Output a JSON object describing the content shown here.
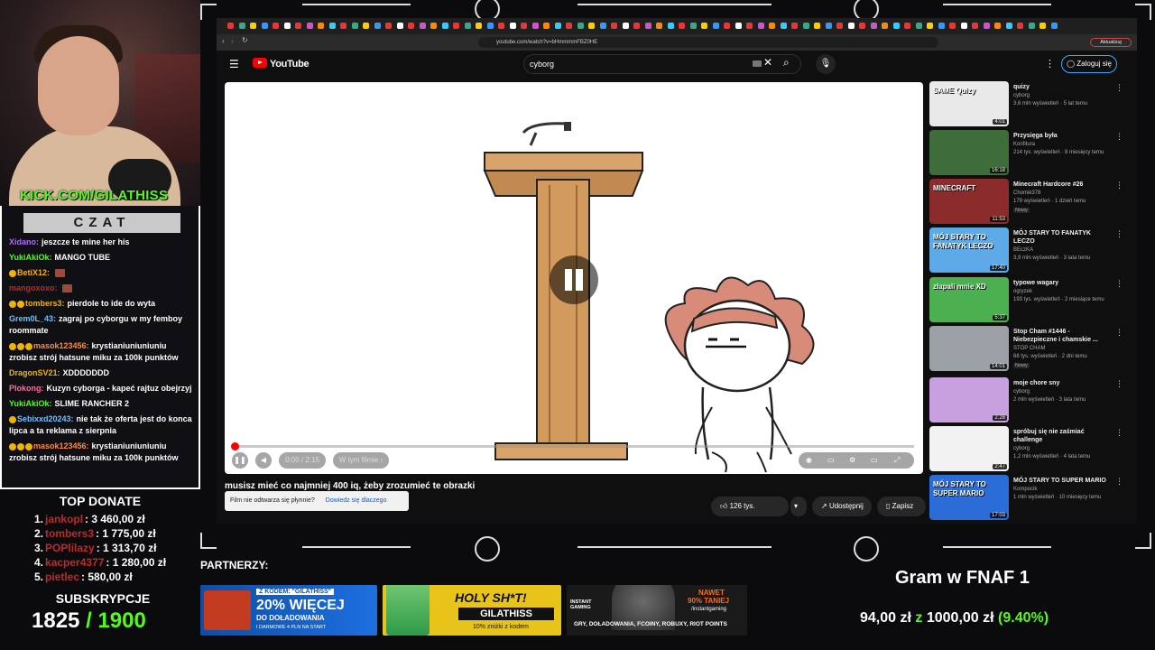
{
  "stream": {
    "kick_url": "KICK.COM/GILATHISS",
    "chat_title": "CZAT",
    "chat": [
      {
        "user": "Xidano:",
        "color": "#b266ff",
        "badges": 0,
        "text": "jeszcze te mine her his"
      },
      {
        "user": "YukiAkiOk:",
        "color": "#53fc18",
        "badges": 0,
        "text": "MANGO TUBE"
      },
      {
        "user": "BetiX12:",
        "color": "#f0b400",
        "badges": 1,
        "text": "",
        "emote": true
      },
      {
        "user": "mangoxoxo:",
        "color": "#c0282a",
        "badges": 0,
        "text": "",
        "emote": true
      },
      {
        "user": "tombers3:",
        "color": "#f0b400",
        "badges": 2,
        "text": "pierdole to ide do wyta"
      },
      {
        "user": "Grem0L_43:",
        "color": "#6ec1ff",
        "badges": 0,
        "text": "zagraj po cyborgu w my femboy roommate"
      },
      {
        "user": "masok123456:",
        "color": "#ff8a3d",
        "badges": 3,
        "text": "krystianiuniuniuniu zrobisz strój hatsune miku za 100k punktów"
      },
      {
        "user": "DragonSV21:",
        "color": "#f0b400",
        "badges": 0,
        "text": "XDDDDDDD"
      },
      {
        "user": "Plokong:",
        "color": "#ff6b9d",
        "badges": 0,
        "text": "Kuzyn cyborga - kapeć rajtuz obejrzyj"
      },
      {
        "user": "YukiAkiOk:",
        "color": "#53fc18",
        "badges": 0,
        "text": "SLIME RANCHER 2"
      },
      {
        "user": "Sebixxd20243:",
        "color": "#6ec1ff",
        "badges": 1,
        "text": "nie tak że oferta jest do konca lipca a ta reklama z sierpnia"
      },
      {
        "user": "masok123456:",
        "color": "#ff8a3d",
        "badges": 3,
        "text": "krystianiuniuniuniu zrobisz strój hatsune miku za 100k punktów"
      }
    ],
    "top_donate_title": "TOP DONATE",
    "donations": [
      {
        "rank": "1.",
        "name": "jankopl",
        "amount": ": 3 460,00 zł"
      },
      {
        "rank": "2.",
        "name": "tombers3",
        "amount": ": 1 775,00 zł"
      },
      {
        "rank": "3.",
        "name": "POPlilazy",
        "amount": ": 1 313,70 zł"
      },
      {
        "rank": "4.",
        "name": "kacper4377",
        "amount": ": 1 280,00 zł"
      },
      {
        "rank": "5.",
        "name": "pietlec",
        "amount": ": 580,00 zł"
      }
    ],
    "subs_title": "SUBSKRYPCJE",
    "subs_current": "1825",
    "subs_goal": "/ 1900",
    "partners_label": "PARTNERZY:",
    "ads": {
      "ad1_line1": "Z KODEM: \"GILATHISS\"",
      "ad1_line2": "20% WIĘCEJ",
      "ad1_line3": "DO DOŁADOWANIA",
      "ad1_line4": "I DARMOWE 4 PLN NA START",
      "ad2_line1": "HOLY SH*T!",
      "ad2_line2": "GILATHISS",
      "ad2_line3": "10% zniżki z kodem",
      "ad3_line1": "NAWET",
      "ad3_line2": "90% TANIEJ",
      "ad3_line3": "/instantgaming",
      "ad3_line4": "GRY, DOŁADOWANIA, FCOINY, ROBUXY, RIOT POINTS",
      "ad3_brand": "INSTANT GAMING"
    },
    "goal_title": "Gram w FNAF 1",
    "goal_current": "94,00 zł",
    "goal_sep": "z",
    "goal_target": "1000,00 zł",
    "goal_percent": "(9.40%)"
  },
  "browser": {
    "url": "youtube.com/watch?v=bHmmmmFBZ0HE",
    "profile": "Aktualizuj"
  },
  "youtube": {
    "logo": "YouTube",
    "search_value": "cyborg",
    "sign_in": "Zaloguj się",
    "video_title": "musisz mieć co najmniej 400 iq, żeby zrozumieć te obrazki",
    "toast_text": "Film nie odtwarza się płynnie?",
    "toast_link": "Dowiedz się dlaczego",
    "time": "0:00 / 2:15",
    "chapter": "W tym filmie  ›",
    "likes": "126 tys.",
    "share": "Udostępnij",
    "save": "Zapisz",
    "recommendations": [
      {
        "title": "quizy",
        "channel": "cyborg",
        "meta": "3,6 mln wyświetleń · 5 lat temu",
        "duration": "4:01",
        "color": "#e9e9e9",
        "thumb_text": "SAME Quizy",
        "isnew": false
      },
      {
        "title": "Przysięga była",
        "channel": "Konfitura",
        "meta": "214 tys. wyświetleń · 8 miesięcy temu",
        "duration": "16:18",
        "color": "#3f6d3a",
        "thumb_text": "",
        "isnew": false
      },
      {
        "title": "Minecraft Hardcore #26",
        "channel": "Chomik378",
        "meta": "179 wyświetleń · 1 dzień temu",
        "duration": "11:53",
        "color": "#8b2b2b",
        "thumb_text": "MINECRAFT",
        "isnew": true
      },
      {
        "title": "MÓJ STARY TO FANATYK LECZO",
        "channel": "BEczKA",
        "meta": "3,9 mln wyświetleń · 3 lata temu",
        "duration": "17:40",
        "color": "#5ea9e8",
        "thumb_text": "MÓJ STARY TO FANATYK LECZO",
        "isnew": false
      },
      {
        "title": "typowe wagary",
        "channel": "ogryzek",
        "meta": "193 tys. wyświetleń · 2 miesiące temu",
        "duration": "5:37",
        "color": "#4caf50",
        "thumb_text": "złapali mnie XD",
        "isnew": false
      },
      {
        "title": "Stop Cham #1446 - Niebezpieczne i chamskie ...",
        "channel": "STOP CHAM",
        "meta": "68 tys. wyświetleń · 2 dni temu",
        "duration": "14:01",
        "color": "#9aa0a6",
        "thumb_text": "",
        "isnew": true
      },
      {
        "title": "moje chore sny",
        "channel": "cyborg",
        "meta": "2 mln wyświetleń · 3 lata temu",
        "duration": "2:28",
        "color": "#c8a0e0",
        "thumb_text": "",
        "isnew": false
      },
      {
        "title": "spróbuj się nie zaśmiać challenge",
        "channel": "cyborg",
        "meta": "1,2 mln wyświetleń · 4 lata temu",
        "duration": "2:47",
        "color": "#f2f2f2",
        "thumb_text": "",
        "isnew": false
      },
      {
        "title": "MÓJ STARY TO SUPER MARIO",
        "channel": "Kompocik",
        "meta": "1 mln wyświetleń · 10 miesięcy temu",
        "duration": "17:03",
        "color": "#2b6cd8",
        "thumb_text": "MÓJ STARY TO SUPER MARIO",
        "isnew": false
      }
    ]
  }
}
